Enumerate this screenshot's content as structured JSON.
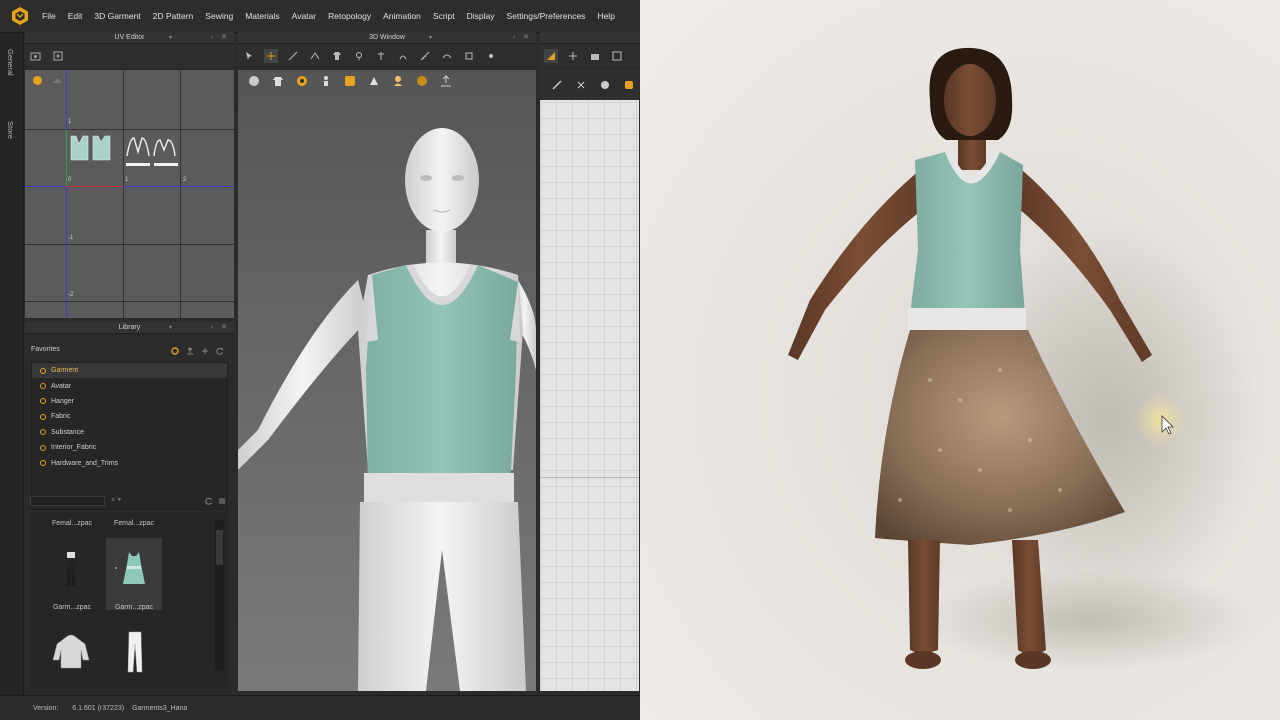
{
  "menu": {
    "items": [
      "File",
      "Edit",
      "3D Garment",
      "2D Pattern",
      "Sewing",
      "Materials",
      "Avatar",
      "Retopology",
      "Animation",
      "Script",
      "Display",
      "Settings/Preferences",
      "Help"
    ]
  },
  "side_tabs": [
    "General",
    "Store"
  ],
  "uv_editor": {
    "title": "UV Editor",
    "axis_labels": [
      "1",
      "0",
      "1",
      "2",
      "-1",
      "-2"
    ]
  },
  "view3d": {
    "title": "3D Window"
  },
  "library": {
    "title": "Library",
    "favorites_label": "Favorites",
    "favorites": [
      "Garment",
      "Avatar",
      "Hanger",
      "Fabric",
      "Substance",
      "Interior_Fabric",
      "Hardware_and_Trims"
    ],
    "selected_index": 0,
    "thumbnails": [
      "Femal...zpac",
      "Femal...zpac",
      "Garm...zpac",
      "Garm...zpac"
    ]
  },
  "status": {
    "version_label": "Version:",
    "version_value": "6.1.601 (r37223)",
    "file_name": "Garments3_Hana"
  },
  "colors": {
    "accent": "#e6a321",
    "panel_bg": "#2b2b2b",
    "garment_top": "#8fbfb3",
    "skirt": "#8a6f58"
  }
}
